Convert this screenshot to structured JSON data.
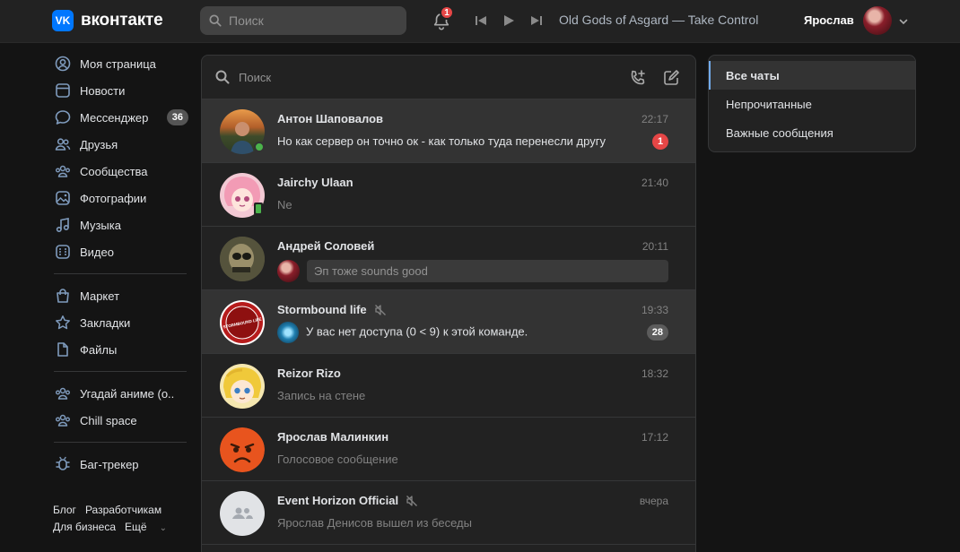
{
  "header": {
    "logo_badge": "VK",
    "logo_text": "вконтакте",
    "search_placeholder": "Поиск",
    "notifications_count": "1",
    "track": "Old Gods of Asgard — Take Control",
    "user_name": "Ярослав"
  },
  "nav": {
    "items": [
      {
        "label": "Моя страница",
        "icon": "user-circle-icon"
      },
      {
        "label": "Новости",
        "icon": "news-icon"
      },
      {
        "label": "Мессенджер",
        "icon": "message-icon",
        "count": "36"
      },
      {
        "label": "Друзья",
        "icon": "friends-icon"
      },
      {
        "label": "Сообщества",
        "icon": "groups-icon"
      },
      {
        "label": "Фотографии",
        "icon": "photo-icon"
      },
      {
        "label": "Музыка",
        "icon": "music-icon"
      },
      {
        "label": "Видео",
        "icon": "video-icon"
      },
      {
        "label": "Маркет",
        "icon": "market-icon"
      },
      {
        "label": "Закладки",
        "icon": "star-icon"
      },
      {
        "label": "Файлы",
        "icon": "file-icon"
      },
      {
        "label": "Угадай аниме (о..",
        "icon": "groups-icon"
      },
      {
        "label": "Chill space",
        "icon": "groups-icon"
      },
      {
        "label": "Баг-трекер",
        "icon": "bug-icon"
      }
    ],
    "footer": [
      "Блог",
      "Разработчикам",
      "Для бизнеса",
      "Ещё"
    ]
  },
  "messages": {
    "search_placeholder": "Поиск",
    "chats": [
      {
        "name": "Антон Шаповалов",
        "time": "22:17",
        "text": "Но как сервер он точно ок - как только туда перенесли другу",
        "unread": "1"
      },
      {
        "name": "Jairchy Ulaan",
        "time": "21:40",
        "text": "Ne"
      },
      {
        "name": "Андрей Соловей",
        "time": "20:11",
        "text": "Эп тоже sounds good"
      },
      {
        "name": "Stormbound life",
        "time": "19:33",
        "text": "У вас нет доступа (0 < 9) к этой команде.",
        "unread": "28",
        "avatar_text": "STORMBOUND LIFE"
      },
      {
        "name": "Reizor Rizo",
        "time": "18:32",
        "text": "Запись на стене"
      },
      {
        "name": "Ярослав Малинкин",
        "time": "17:12",
        "text": "Голосовое сообщение"
      },
      {
        "name": "Event Horizon Official",
        "time": "вчера",
        "text": "Ярослав Денисов вышел из беседы"
      }
    ]
  },
  "filter": {
    "items": [
      "Все чаты",
      "Непрочитанные",
      "Важные сообщения"
    ]
  },
  "colors": {
    "accent": "#0077ff",
    "unread_badge": "#e64646",
    "online": "#4bb34b",
    "active_filter_border": "#71aaeb"
  }
}
